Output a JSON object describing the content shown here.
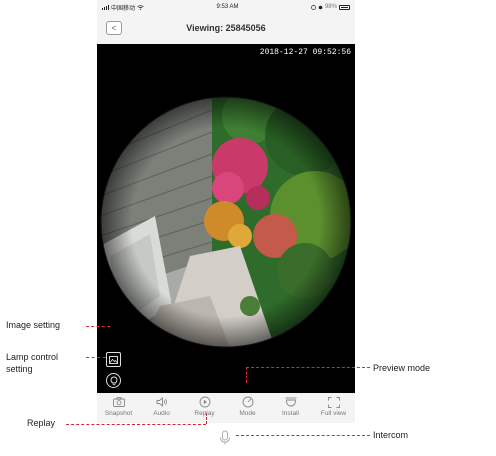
{
  "status_bar": {
    "carrier": "中国移动",
    "time": "9:53 AM",
    "battery": "98%"
  },
  "nav": {
    "back": "<",
    "title": "Viewing: 25845056"
  },
  "video": {
    "timestamp": "2018-12-27 09:52:56"
  },
  "toolbar": {
    "items": [
      {
        "label": "Snapshot",
        "icon": "camera-icon"
      },
      {
        "label": "Audio",
        "icon": "speaker-icon"
      },
      {
        "label": "Replay",
        "icon": "replay-icon"
      },
      {
        "label": "Mode",
        "icon": "mode-icon"
      },
      {
        "label": "Install",
        "icon": "install-icon"
      },
      {
        "label": "Full view",
        "icon": "fullscreen-icon"
      }
    ]
  },
  "intercom": {
    "icon": "microphone-icon"
  },
  "callouts": {
    "image_setting": "Image setting",
    "lamp_control_line1": "Lamp control",
    "lamp_control_line2": "setting",
    "preview_mode": "Preview mode",
    "replay": "Replay",
    "intercom": "Intercom"
  },
  "colors": {
    "callout_line": "#e0242b",
    "video_bg": "#000000",
    "app_bg": "#f4f4f4"
  }
}
